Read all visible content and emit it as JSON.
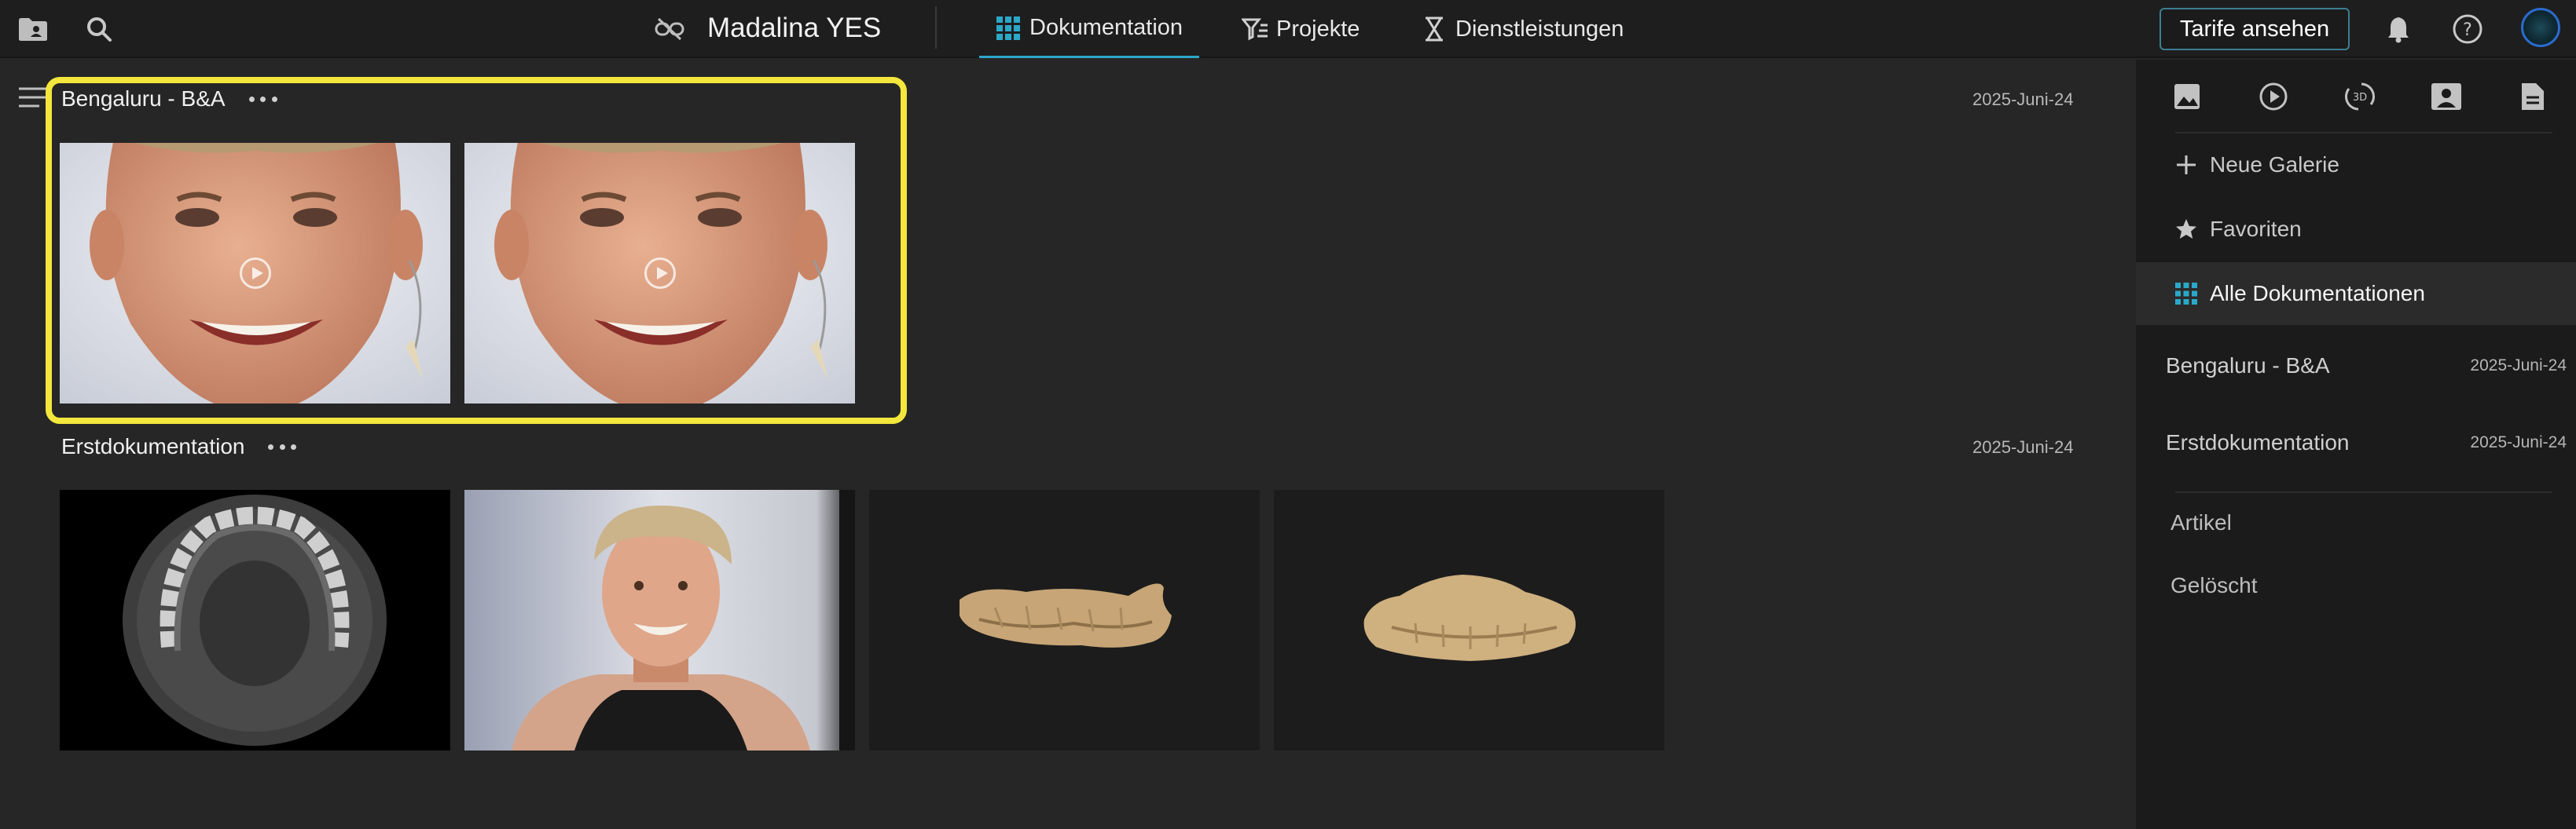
{
  "topbar": {
    "project_title": "Madalina YES",
    "tabs": [
      {
        "label": "Dokumentation",
        "icon": "grid-icon",
        "active": true
      },
      {
        "label": "Projekte",
        "icon": "filter-icon",
        "active": false
      },
      {
        "label": "Dienstleistungen",
        "icon": "hourglass-icon",
        "active": false
      }
    ],
    "cta_label": "Tarife ansehen",
    "accent_color": "#2ba8c8"
  },
  "main": {
    "sections": [
      {
        "title": "Bengaluru - B&A",
        "date": "2025-Juni-24",
        "highlighted": true,
        "items": [
          {
            "kind": "video",
            "subject": "smiling woman face"
          },
          {
            "kind": "video",
            "subject": "smiling woman face"
          }
        ]
      },
      {
        "title": "Erstdokumentation",
        "date": "2025-Juni-24",
        "highlighted": false,
        "items": [
          {
            "kind": "image",
            "subject": "dental CT scan"
          },
          {
            "kind": "image",
            "subject": "portrait photo"
          },
          {
            "kind": "3d",
            "subject": "3D dental scan side view"
          },
          {
            "kind": "3d",
            "subject": "3D dental scan front view"
          }
        ]
      }
    ],
    "highlight_color": "#f3e63c"
  },
  "sidebar": {
    "filter_icons": [
      "image-icon",
      "play-icon",
      "3d-rotate-icon",
      "portrait-icon",
      "document-icon"
    ],
    "actions": [
      {
        "label": "Neue Galerie",
        "icon": "plus-icon"
      },
      {
        "label": "Favoriten",
        "icon": "star-icon"
      },
      {
        "label": "Alle Dokumentationen",
        "icon": "grid-icon",
        "active": true
      }
    ],
    "galleries": [
      {
        "name": "Bengaluru - B&A",
        "date": "2025-Juni-24"
      },
      {
        "name": "Erstdokumentation",
        "date": "2025-Juni-24"
      }
    ],
    "links": [
      {
        "label": "Artikel"
      },
      {
        "label": "Gelöscht"
      }
    ]
  }
}
